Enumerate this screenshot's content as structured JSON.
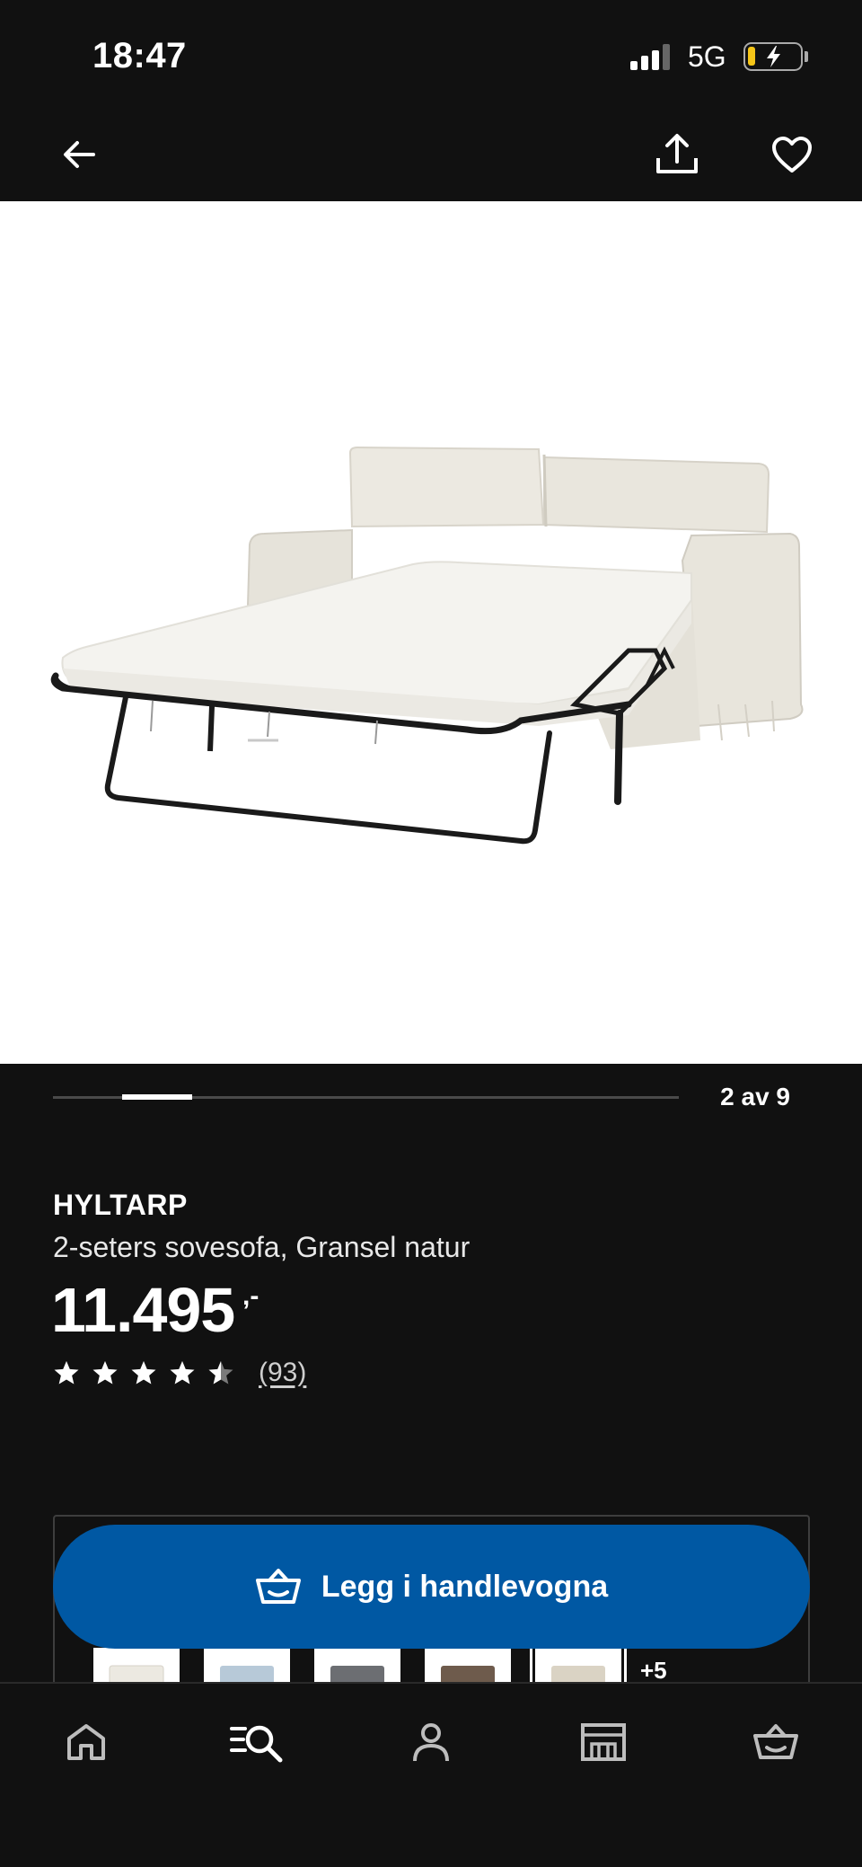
{
  "status_bar": {
    "time": "18:47",
    "network": "5G",
    "icons": [
      "signal-icon",
      "battery-charging-icon"
    ]
  },
  "top_nav": {
    "icons": [
      "back-arrow-icon",
      "share-icon",
      "heart-icon"
    ]
  },
  "carousel": {
    "counter": "2 av 9",
    "current": 2,
    "total": 9
  },
  "product": {
    "name": "HYLTARP",
    "description": "2-seters sovesofa, Gransel natur",
    "price": "11.495",
    "price_suffix": ",-",
    "rating_stars": 4.5,
    "review_count": "(93)"
  },
  "cart": {
    "button_label": "Legg i handlevogna",
    "icon": "basket-icon"
  },
  "variants": {
    "more_label": "+5",
    "swatches": [
      "#ece9e1",
      "#b7c9d8",
      "#6c6e72",
      "#6e5b4c",
      "#dad3c4"
    ]
  },
  "tab_bar": {
    "tabs": [
      "home-icon",
      "search-menu-icon",
      "profile-icon",
      "store-icon",
      "basket-icon"
    ]
  },
  "colors": {
    "background": "#111111",
    "accent_blue": "#0058a3",
    "text": "#ffffff"
  }
}
